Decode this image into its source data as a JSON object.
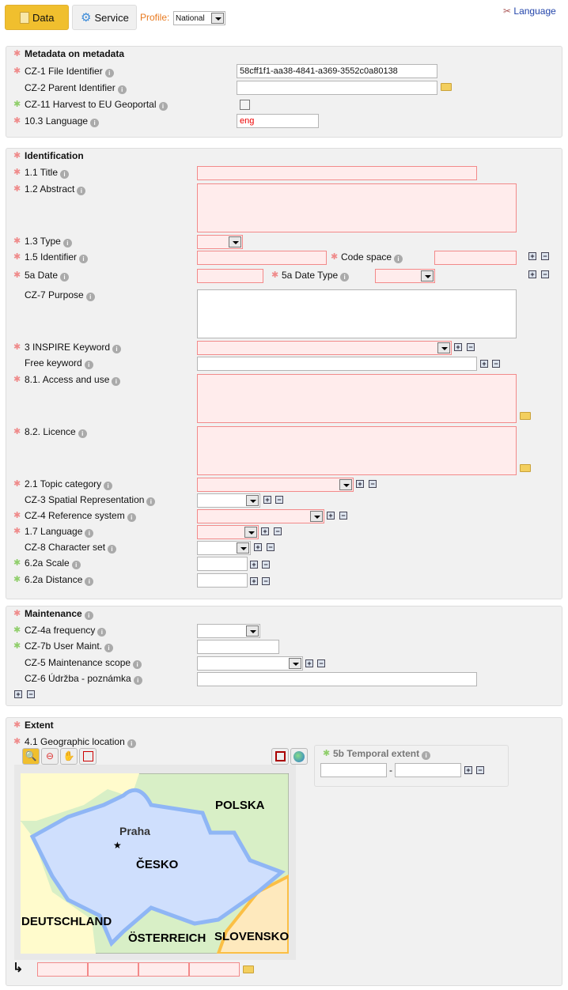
{
  "header": {
    "data_tab": "Data",
    "service_tab": "Service",
    "profile_label": "Profile:",
    "profile_value": "National",
    "language_link": "Language"
  },
  "colors": {
    "required": "#ef8a8a",
    "conditional": "#8fce6a",
    "accent": "#f0c030",
    "profile": "#e87a20"
  },
  "meta": {
    "title": "Metadata on metadata",
    "file_id_label": "CZ-1 File Identifier",
    "file_id_value": "58cff1f1-aa38-4841-a369-3552c0a80138",
    "parent_label": "CZ-2 Parent Identifier",
    "harvest_label": "CZ-11 Harvest to EU Geoportal",
    "harvest_checked": false,
    "lang_label": "10.3 Language",
    "lang_value": "eng"
  },
  "ident": {
    "title": "Identification",
    "title_label": "1.1 Title",
    "abstract_label": "1.2 Abstract",
    "type_label": "1.3 Type",
    "identifier_label": "1.5 Identifier",
    "codespace_label": "Code space",
    "date_label": "5a Date",
    "datetype_label": "5a Date Type",
    "purpose_label": "CZ-7 Purpose",
    "inspire_label": "3 INSPIRE Keyword",
    "free_label": "Free keyword",
    "access_label": "8.1. Access and use",
    "licence_label": "8.2. Licence",
    "topic_label": "2.1 Topic category",
    "spatial_label": "CZ-3 Spatial Representation",
    "refsys_label": "CZ-4 Reference system",
    "lang_label": "1.7 Language",
    "charset_label": "CZ-8 Character set",
    "scale_label": "6.2a Scale",
    "distance_label": "6.2a Distance"
  },
  "maint": {
    "title": "Maintenance",
    "freq_label": "CZ-4a frequency",
    "user_label": "CZ-7b User Maint.",
    "scope_label": "CZ-5 Maintenance scope",
    "note_label": "CZ-6 Údržba - poznámka"
  },
  "extent": {
    "title": "Extent",
    "geo_label": "4.1 Geographic location",
    "temporal_label": "5b Temporal extent",
    "temporal_sep": "-",
    "map_labels": {
      "polska": "POLSKA",
      "praha": "Praha",
      "cesko": "ČESKO",
      "deutschland": "DEUTSCHLAND",
      "osterreich": "ÖSTERREICH",
      "slovensko": "SLOVENSKO"
    }
  }
}
